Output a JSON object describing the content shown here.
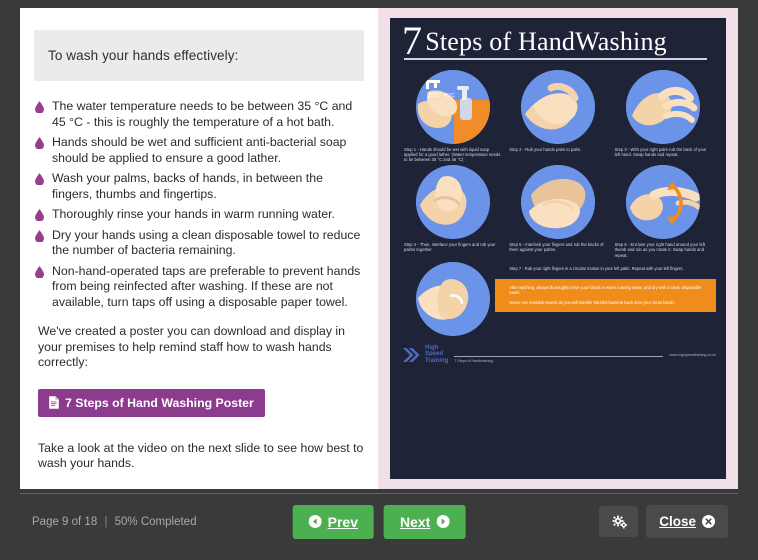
{
  "slide": {
    "lead": "To wash your hands effectively:",
    "bullets": [
      "The water temperature needs to be between 35 °C and 45 °C - this is roughly the temperature of a hot bath.",
      "Hands should be wet and sufficient anti-bacterial soap should be applied to ensure a good lather.",
      "Wash your palms, backs of hands, in between the fingers, thumbs and fingertips.",
      "Thoroughly rinse your hands in warm running water.",
      "Dry your hands using a clean disposable towel to reduce the number of bacteria remaining.",
      "Non-hand-operated taps are preferable to prevent hands from being reinfected after washing. If these are not available, turn taps off using a disposable paper towel."
    ],
    "paragraph": "We've created a poster you can download and display in your premises to help remind staff how to wash hands correctly:",
    "poster_link_label": "7 Steps of Hand Washing Poster",
    "tail_paragraph": "Take a look at the video on the next slide to see how best to wash your hands."
  },
  "poster": {
    "title_number": "7",
    "title_rest": "Steps of HandWashing",
    "temperature_label": "35°C - 45°C",
    "steps": [
      "Step 1 - Hands should be wet with liquid soap applied for a good lather. (Water temperature needs to be between 35 °C and 45 °C)",
      "Step 2 - Rub your hands palm to palm.",
      "Step 3 - With your right palm rub the back of your left hand. Swap hands and repeat.",
      "Step 4 - Then, interlace your fingers and rub your palms together.",
      "Step 5 - Interlock your fingers and rub the backs of them against your palms.",
      "Step 6 - Enclose your right hand around your left thumb and rub as you rotate it. Swap hands and repeat.",
      "Step 7 - Rub your right fingers in a circular motion in your left palm. Repeat with your left fingers."
    ],
    "notes": [
      "After washing, always thoroughly rinse your hands in warm running water, and dry with a clean disposable towel.",
      "Never use reusable towels as you will transfer harmful bacteria back onto your clean hands."
    ],
    "logo_line1": "High",
    "logo_line2": "Speed",
    "logo_line3": "Training",
    "footer_caption": "7 Steps of Handwashing",
    "footer_url": "www.highspeedtraining.co.uk"
  },
  "navbar": {
    "page_status": "Page 9 of 18",
    "separator": "|",
    "completion": "50% Completed",
    "prev_label": "Prev",
    "next_label": "Next",
    "close_label": "Close"
  },
  "colors": {
    "accent_purple": "#8d3b8d",
    "green_button": "#4caf50",
    "poster_navy": "#1e2338",
    "poster_blue": "#6b93e8",
    "poster_orange": "#f08c19",
    "poster_frame_pink": "#f0dfe8",
    "chrome_dark": "#3a3a3a"
  }
}
